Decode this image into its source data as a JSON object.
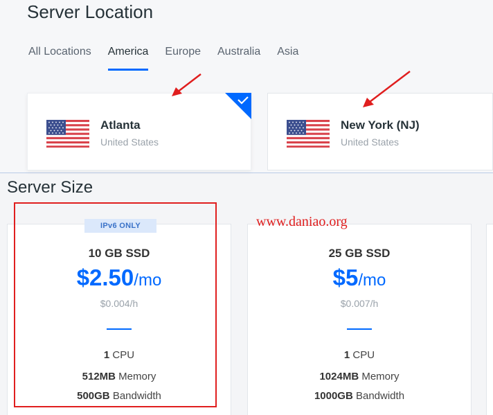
{
  "location": {
    "title": "Server Location",
    "tabs": [
      {
        "label": "All Locations",
        "active": false
      },
      {
        "label": "America",
        "active": true
      },
      {
        "label": "Europe",
        "active": false
      },
      {
        "label": "Australia",
        "active": false
      },
      {
        "label": "Asia",
        "active": false
      }
    ],
    "cards": [
      {
        "name": "Atlanta",
        "country": "United States",
        "selected": true
      },
      {
        "name": "New York (NJ)",
        "country": "United States",
        "selected": false
      }
    ]
  },
  "size": {
    "title": "Server Size",
    "plans": [
      {
        "badge": "IPv6 ONLY",
        "storage": "10 GB SSD",
        "price": "$2.50",
        "period": "/mo",
        "hourly": "$0.004/h",
        "cpu_value": "1",
        "cpu_label": "CPU",
        "memory_value": "512MB",
        "memory_label": "Memory",
        "bandwidth_value": "500GB",
        "bandwidth_label": "Bandwidth"
      },
      {
        "storage": "25 GB SSD",
        "price": "$5",
        "period": "/mo",
        "hourly": "$0.007/h",
        "cpu_value": "1",
        "cpu_label": "CPU",
        "memory_value": "1024MB",
        "memory_label": "Memory",
        "bandwidth_value": "1000GB",
        "bandwidth_label": "Bandwidth"
      }
    ]
  },
  "watermark": "www.daniao.org",
  "colors": {
    "accent": "#0069ff",
    "annotation": "#e01e1e"
  }
}
